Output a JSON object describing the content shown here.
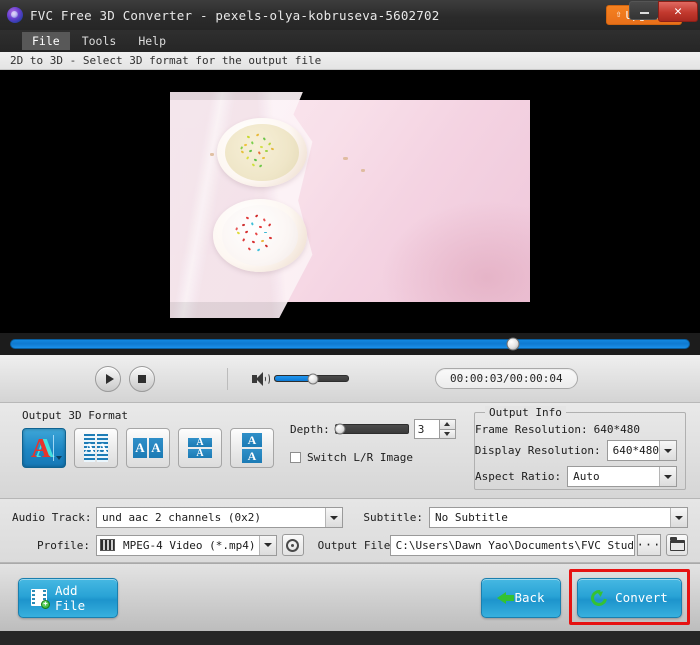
{
  "window": {
    "title": "FVC Free 3D Converter - pexels-olya-kobruseva-5602702",
    "upgrade_label": "Upgrade",
    "upgrade_icon": "up-arrow-icon",
    "logo_icon": "fvc-logo-icon",
    "minimize_label": "",
    "close_label": "✕"
  },
  "menubar": {
    "items": [
      {
        "label": "File",
        "active": true
      },
      {
        "label": "Tools",
        "active": false
      },
      {
        "label": "Help",
        "active": false
      }
    ]
  },
  "hint": {
    "text": "2D to 3D - Select 3D format for the output file"
  },
  "preview": {
    "description": "Two frosted donuts with colorful sprinkles on pink tissue paper"
  },
  "player": {
    "seek_percent": 74,
    "play_icon": "play-icon",
    "stop_icon": "stop-icon",
    "volume_icon": "speaker-icon",
    "volume_percent": 52,
    "time_display": "00:00:03/00:00:04"
  },
  "format_panel": {
    "group_label": "Output 3D Format",
    "buttons": [
      {
        "name": "anaglyph",
        "letters": "A",
        "selected": true
      },
      {
        "name": "interlaced",
        "letters": "AA",
        "selected": false
      },
      {
        "name": "side-by-side",
        "letters": "AA",
        "selected": false
      },
      {
        "name": "top-bottom-half",
        "letters": "AA",
        "selected": false
      },
      {
        "name": "top-bottom-full",
        "letters": "AA",
        "selected": false
      }
    ],
    "depth_label": "Depth:",
    "depth_value": "3",
    "depth_percent": 4,
    "switch_label": "Switch L/R Image",
    "switch_checked": false
  },
  "output_info": {
    "legend": "Output Info",
    "frame_resolution_label": "Frame Resolution:",
    "frame_resolution_value": "640*480",
    "display_resolution_label": "Display Resolution:",
    "display_resolution_value": "640*480",
    "aspect_ratio_label": "Aspect Ratio:",
    "aspect_ratio_value": "Auto"
  },
  "settings": {
    "audio_track_label": "Audio Track:",
    "audio_track_value": "und aac 2 channels (0x2)",
    "subtitle_label": "Subtitle:",
    "subtitle_value": "No Subtitle",
    "profile_label": "Profile:",
    "profile_value": "MPEG-4 Video (*.mp4)",
    "profile_icon": "video-file-icon",
    "settings_icon": "gear-icon",
    "output_file_label": "Output File:",
    "output_file_value": "C:\\Users\\Dawn Yao\\Documents\\FVC Stud",
    "browse_dots_label": "···",
    "folder_icon": "folder-icon"
  },
  "bottom": {
    "add_file_label": "Add File",
    "add_file_icon": "add-film-icon",
    "back_label": "Back",
    "back_icon": "back-arrow-icon",
    "convert_label": "Convert",
    "convert_icon": "convert-refresh-icon",
    "highlight_color": "#e61212"
  },
  "colors": {
    "accent_blue": "#1d94cc",
    "upgrade_orange": "#f58220",
    "close_red": "#c2392e",
    "seek_blue": "#1288e0"
  }
}
